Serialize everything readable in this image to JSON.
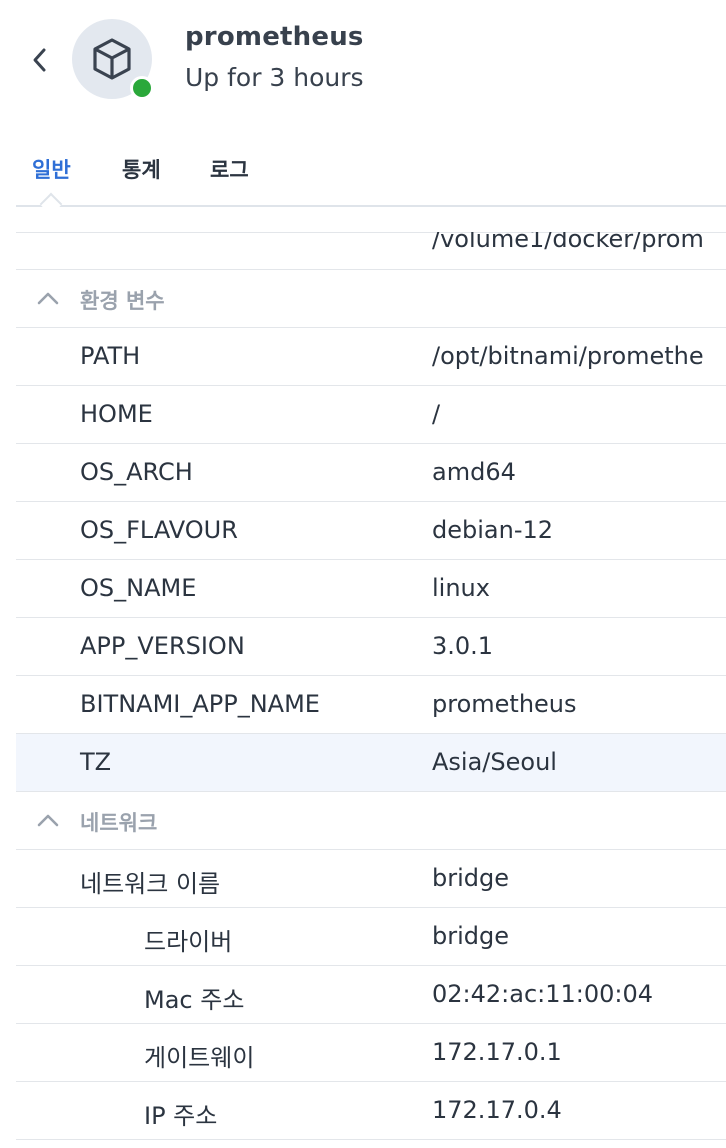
{
  "header": {
    "name": "prometheus",
    "status": "Up for 3 hours",
    "status_color": "#2aa83a",
    "icon": "cube-icon"
  },
  "tabs": [
    {
      "label": "일반",
      "active": true
    },
    {
      "label": "통계",
      "active": false
    },
    {
      "label": "로그",
      "active": false
    }
  ],
  "top_row": {
    "value": "/volume1/docker/prom"
  },
  "env_section": {
    "title": "환경 변수",
    "rows": [
      {
        "key": "PATH",
        "value": "/opt/bitnami/promethe"
      },
      {
        "key": "HOME",
        "value": "/"
      },
      {
        "key": "OS_ARCH",
        "value": "amd64"
      },
      {
        "key": "OS_FLAVOUR",
        "value": "debian-12"
      },
      {
        "key": "OS_NAME",
        "value": "linux"
      },
      {
        "key": "APP_VERSION",
        "value": "3.0.1"
      },
      {
        "key": "BITNAMI_APP_NAME",
        "value": "prometheus"
      },
      {
        "key": "TZ",
        "value": "Asia/Seoul"
      }
    ]
  },
  "network_section": {
    "title": "네트워크",
    "rows": [
      {
        "key": "네트워크 이름",
        "value": "bridge"
      },
      {
        "key": "드라이버",
        "value": "bridge"
      },
      {
        "key": "Mac 주소",
        "value": "02:42:ac:11:00:04"
      },
      {
        "key": "게이트웨이",
        "value": "172.17.0.1"
      },
      {
        "key": "IP 주소",
        "value": "172.17.0.4"
      }
    ]
  },
  "accent_color": "#2f6fd6"
}
